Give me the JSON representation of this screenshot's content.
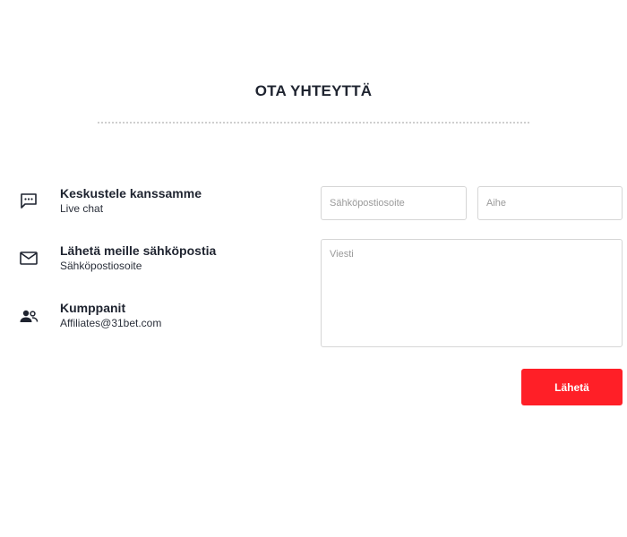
{
  "header": {
    "title": "OTA YHTEYTTÄ"
  },
  "contact_items": [
    {
      "icon": "chat-icon",
      "title": "Keskustele kanssamme",
      "subtitle": "Live chat"
    },
    {
      "icon": "mail-icon",
      "title": "Lähetä meille sähköpostia",
      "subtitle": "Sähköpostiosoite"
    },
    {
      "icon": "people-icon",
      "title": "Kumppanit",
      "subtitle": "Affiliates@31bet.com"
    }
  ],
  "form": {
    "email_placeholder": "Sähköpostiosoite",
    "email_value": "",
    "subject_placeholder": "Aihe",
    "subject_value": "",
    "message_placeholder": "Viesti",
    "message_value": "",
    "submit_label": "Lähetä"
  },
  "colors": {
    "accent": "#ff1f27",
    "text": "#1f2430",
    "border": "#d6d6d6"
  }
}
